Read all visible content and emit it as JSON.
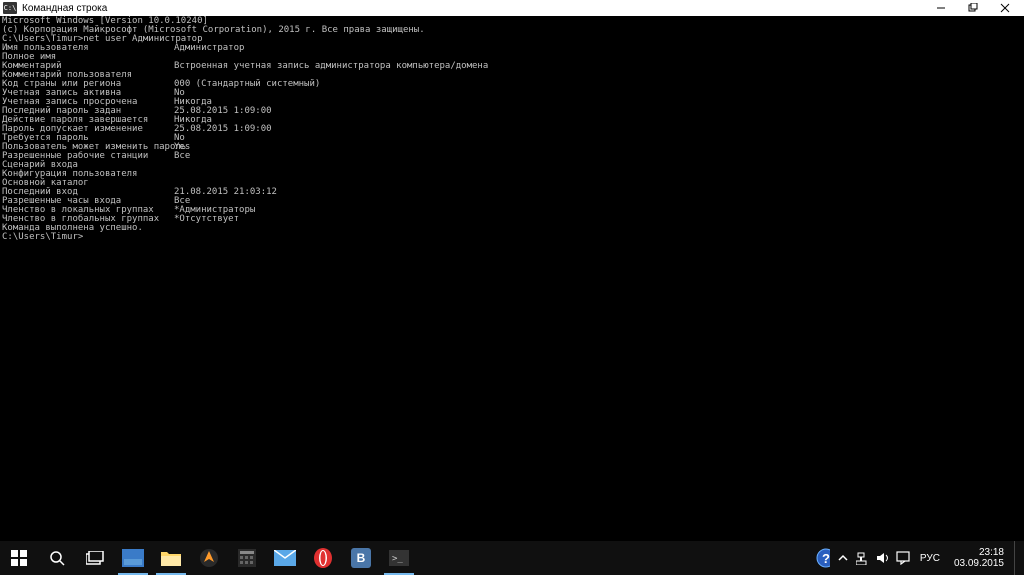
{
  "window": {
    "icon_text": "C:\\",
    "title": "Командная строка"
  },
  "console": {
    "header1": "Microsoft Windows [Version 10.0.10240]",
    "header2": "(с) Корпорация Майкрософт (Microsoft Corporation), 2015 г. Все права защищены.",
    "prompt1": "C:\\Users\\Timur>net user Администратор",
    "rows1": [
      {
        "k": "Имя пользователя",
        "v": "Администратор"
      },
      {
        "k": "Полное имя",
        "v": ""
      },
      {
        "k": "Комментарий",
        "v": "Встроенная учетная запись администратора компьютера/домена"
      },
      {
        "k": "Комментарий пользователя",
        "v": ""
      },
      {
        "k": "Код страны или региона",
        "v": "000 (Стандартный системный)"
      },
      {
        "k": "Учетная запись активна",
        "v": "No"
      },
      {
        "k": "Учетная запись просрочена",
        "v": "Никогда"
      }
    ],
    "rows2": [
      {
        "k": "Последний пароль задан",
        "v": "25.08.2015 1:09:00"
      },
      {
        "k": "Действие пароля завершается",
        "v": "Никогда"
      },
      {
        "k": "Пароль допускает изменение",
        "v": "25.08.2015 1:09:00"
      },
      {
        "k": "Требуется пароль",
        "v": "No"
      },
      {
        "k": "Пользователь может изменить пароль",
        "v": "Yes"
      }
    ],
    "rows3": [
      {
        "k": "Разрешенные рабочие станции",
        "v": "Все"
      },
      {
        "k": "Сценарий входа",
        "v": ""
      },
      {
        "k": "Конфигурация пользователя",
        "v": ""
      },
      {
        "k": "Основной каталог",
        "v": ""
      },
      {
        "k": "Последний вход",
        "v": "21.08.2015 21:03:12"
      }
    ],
    "rows4": [
      {
        "k": "Разрешенные часы входа",
        "v": "Все"
      }
    ],
    "rows5": [
      {
        "k": "Членство в локальных группах",
        "v": "*Администраторы"
      },
      {
        "k": "Членство в глобальных группах",
        "v": "*Отсутствует"
      }
    ],
    "success": "Команда выполнена успешно.",
    "prompt2": "C:\\Users\\Timur>"
  },
  "taskbar": {
    "lang": "РУС",
    "time": "23:18",
    "date": "03.09.2015"
  }
}
